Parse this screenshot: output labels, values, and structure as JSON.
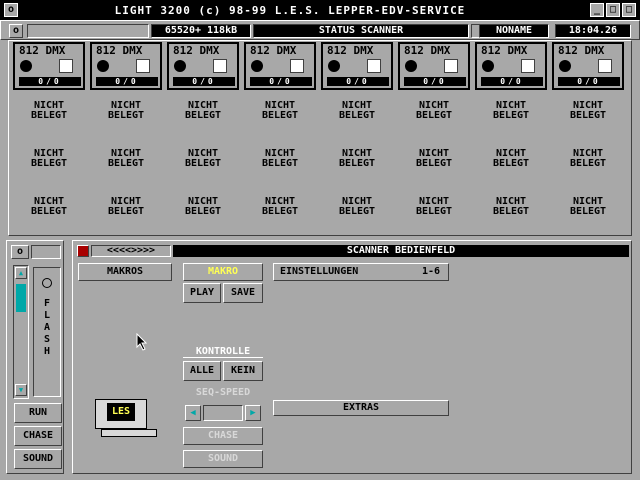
{
  "titlebar": {
    "title": "LIGHT 3200 (c) 98-99 L.E.S. LEPPER-EDV-SERVICE",
    "close_icon": "o",
    "minimize_icon": "_",
    "maximize_icon": "□"
  },
  "statusrow": {
    "memory": "65520+ 118kB",
    "status": "STATUS SCANNER",
    "name": "NONAME",
    "time": "18:04.26"
  },
  "channels": [
    {
      "label": "812 DMX",
      "bar": "0/0"
    },
    {
      "label": "812 DMX",
      "bar": "0/0"
    },
    {
      "label": "812 DMX",
      "bar": "0/0"
    },
    {
      "label": "812 DMX",
      "bar": "0/0"
    },
    {
      "label": "812 DMX",
      "bar": "0/0"
    },
    {
      "label": "812 DMX",
      "bar": "0/0"
    },
    {
      "label": "812 DMX",
      "bar": "0/0"
    },
    {
      "label": "812 DMX",
      "bar": "0/0"
    }
  ],
  "not_assigned": {
    "line1": "NICHT",
    "line2": "BELEGT"
  },
  "leftpanel": {
    "flash_label": "FLASH",
    "run": "RUN",
    "chase": "CHASE",
    "sound": "SOUND",
    "scroll_up": "▲",
    "scroll_down": "▼"
  },
  "bedien": {
    "title": "SCANNER BEDIENFELD",
    "nav": "<<<<>>>>",
    "makros": "MAKROS",
    "makro": "MAKRO",
    "play": "PLAY",
    "save": "SAVE",
    "einstellungen": "EINSTELLUNGEN",
    "einstellungen_range": "1-6",
    "kontrolle": "KONTROLLE",
    "alle": "ALLE",
    "kein": "KEIN",
    "seq_speed": "SEQ-SPEED",
    "chase": "CHASE",
    "sound": "SOUND",
    "extras": "EXTRAS",
    "logo": "LES"
  },
  "colors": {
    "accent_yellow": "#ffff54",
    "teal": "#00a8a8",
    "red": "#a80000"
  }
}
